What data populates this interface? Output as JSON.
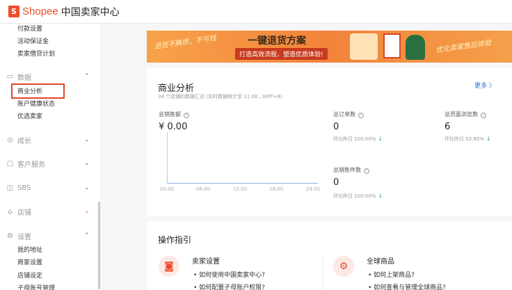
{
  "brand": {
    "bag": "S",
    "name": "Shopee",
    "subtitle": "中国卖家中心"
  },
  "sidebar": {
    "sub_top": [
      "付款设置",
      "活动保证金",
      "卖家借贷计划"
    ],
    "data_group": {
      "label": "数据",
      "icon": "chart-icon",
      "chev": "⌃"
    },
    "data_items": [
      "商业分析",
      "账户健康状态",
      "优选卖家"
    ],
    "groups": [
      {
        "label": "成长",
        "icon": "growth-icon",
        "chev": "⌄"
      },
      {
        "label": "客户服务",
        "icon": "customer-service-icon",
        "chev": "⌄"
      },
      {
        "label": "SBS",
        "icon": "sbs-icon",
        "chev": "⌄"
      },
      {
        "label": "店铺",
        "icon": "shop-icon",
        "chev": "⌄",
        "chev_color": "#ee4d2d"
      }
    ],
    "settings_group": {
      "label": "设置",
      "icon": "gear-icon",
      "chev": "⌃"
    },
    "settings_items": [
      "我的地址",
      "商家设置",
      "店铺设定",
      "子母账号管理"
    ]
  },
  "banner": {
    "left_slogan": "退货不麻烦，不亏钱",
    "title": "一键退货方案",
    "subtitle": "打造高效流程，塑造优质体验!",
    "right_slogan": "优化卖家售后体验"
  },
  "analysis": {
    "title": "商业分析",
    "subtitle": "34 个店铺的数据汇总 (实时数据统计至 11:00 , GMT+8)",
    "more": "更多 〉",
    "sales": {
      "label": "总销售额",
      "value": "¥ 0.00"
    },
    "orders": {
      "label": "总订单数",
      "value": "0",
      "cmp": "环比昨日 100.00%"
    },
    "views": {
      "label": "总页面浏览数",
      "value": "6",
      "cmp": "环比昨日 53.85%"
    },
    "items": {
      "label": "总销售件数",
      "value": "0",
      "cmp": "环比昨日 100.00%"
    },
    "ticks": [
      "00:00",
      "06:00",
      "12:00",
      "18:00",
      "24:00"
    ]
  },
  "guide": {
    "title": "操作指引",
    "seller": {
      "head": "卖家设置",
      "links": [
        "如何使用中国卖家中心?",
        "如何配置子母账户权限?"
      ]
    },
    "global": {
      "head": "全球商品",
      "links": [
        "如何上架商品?",
        "如何查看与管理全球商品?"
      ]
    }
  }
}
